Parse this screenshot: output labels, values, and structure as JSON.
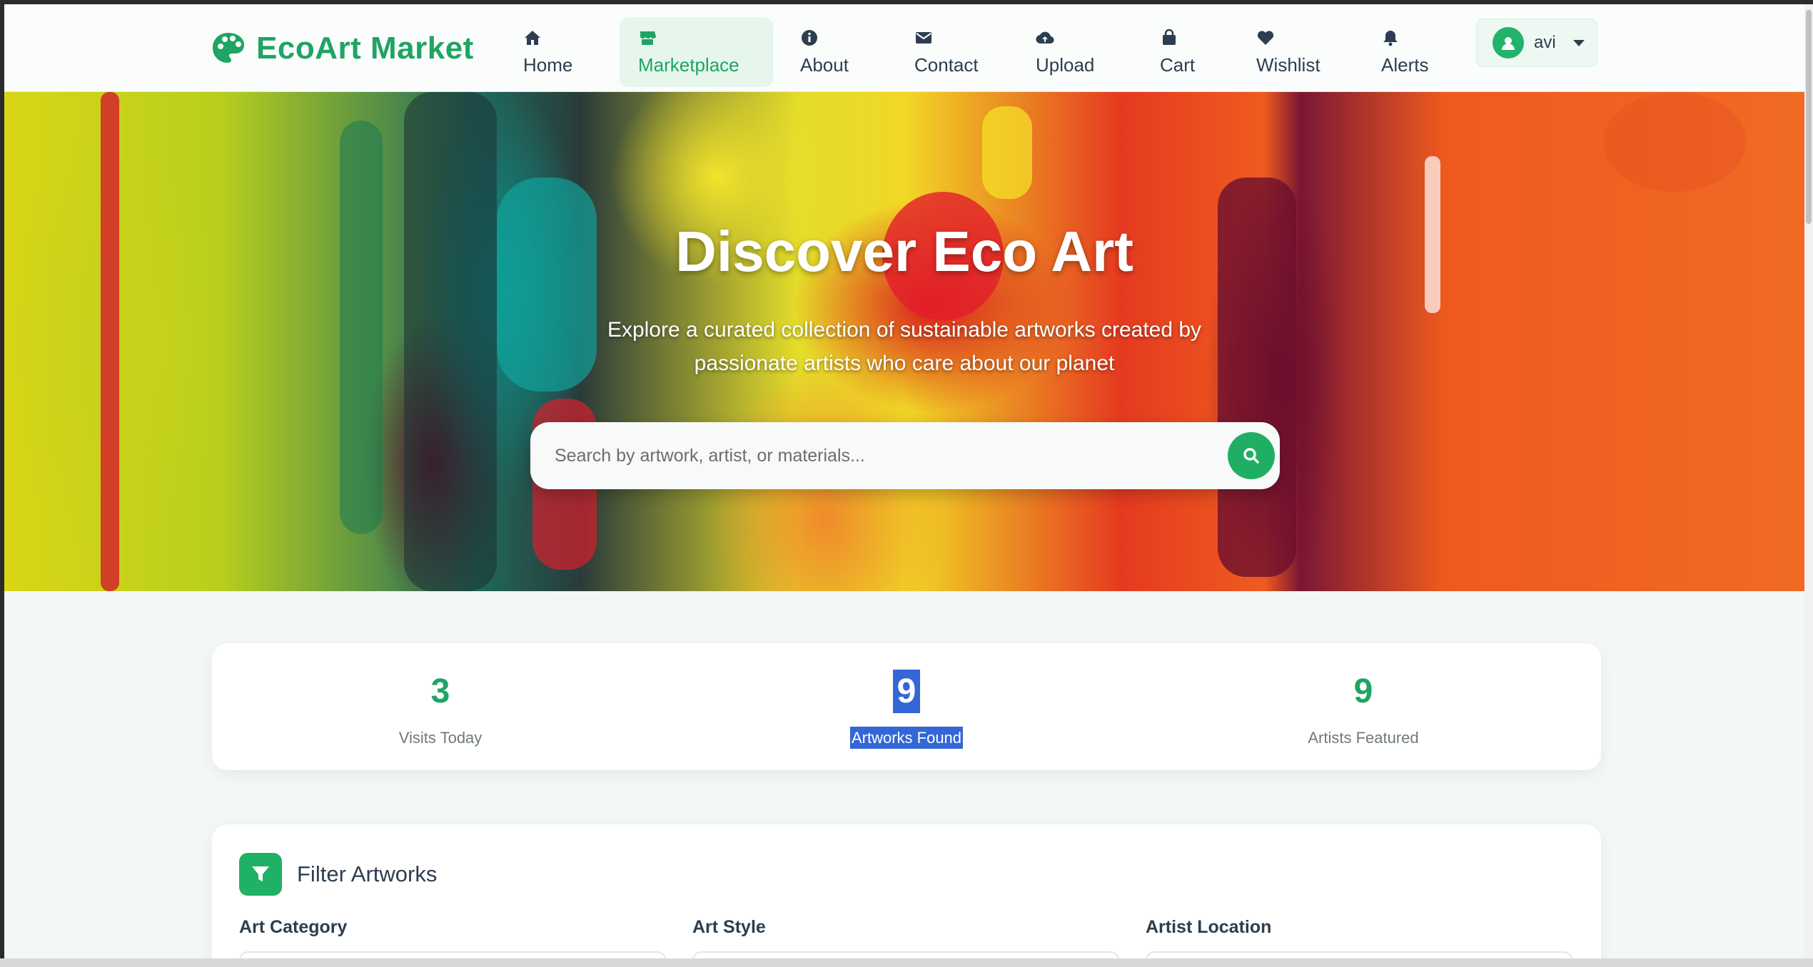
{
  "brand": {
    "name": "EcoArt Market",
    "accent": "#1fa463"
  },
  "nav": {
    "items": [
      {
        "label": "Home",
        "icon": "home-icon"
      },
      {
        "label": "Marketplace",
        "icon": "store-icon",
        "active": true
      },
      {
        "label": "About",
        "icon": "info-icon"
      },
      {
        "label": "Contact",
        "icon": "envelope-icon"
      },
      {
        "label": "Upload",
        "icon": "cloud-upload-icon"
      },
      {
        "label": "Cart",
        "icon": "shopping-bag-icon"
      },
      {
        "label": "Wishlist",
        "icon": "heart-icon"
      },
      {
        "label": "Alerts",
        "icon": "bell-icon"
      }
    ],
    "user": {
      "name": "avi",
      "icon": "user-circle-icon"
    }
  },
  "hero": {
    "title": "Discover Eco Art",
    "subtitle_line1": "Explore a curated collection of sustainable artworks created by",
    "subtitle_line2": "passionate artists who care about our planet",
    "search_placeholder": "Search by artwork, artist, or materials...",
    "search_icon": "search-icon"
  },
  "stats": [
    {
      "value": "3",
      "label": "Visits Today"
    },
    {
      "value": "9",
      "label": "Artworks Found",
      "selected": true
    },
    {
      "value": "9",
      "label": "Artists Featured"
    }
  ],
  "filter": {
    "title": "Filter Artworks",
    "icon": "filter-icon",
    "fields": [
      {
        "label": "Art Category"
      },
      {
        "label": "Art Style"
      },
      {
        "label": "Artist Location"
      }
    ]
  }
}
